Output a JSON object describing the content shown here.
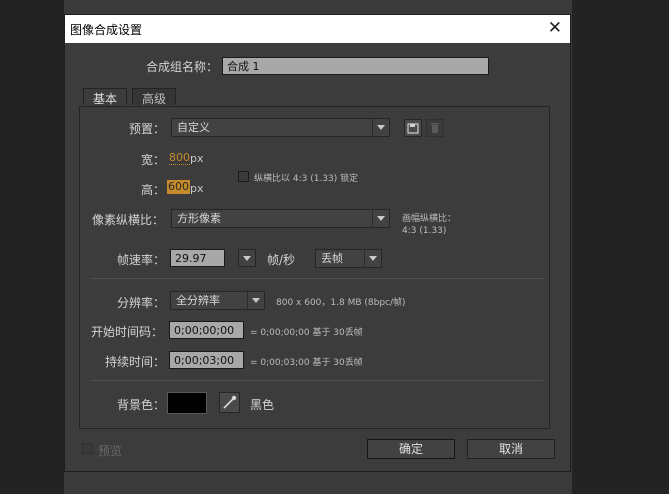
{
  "window": {
    "title": "图像合成设置",
    "close_glyph": "✕"
  },
  "comp_name": {
    "label": "合成组名称：",
    "value": "合成 1"
  },
  "tabs": [
    {
      "label": "基本"
    },
    {
      "label": "高级"
    }
  ],
  "preset": {
    "label": "预置：",
    "value": "自定义"
  },
  "width": {
    "label": "宽：",
    "value": "800",
    "unit": "px"
  },
  "height": {
    "label": "高：",
    "value": "600",
    "unit": "px"
  },
  "lock_aspect": {
    "label": "纵横比以 4:3 (1.33) 锁定",
    "checked": false
  },
  "pixel_aspect": {
    "label": "像素纵横比：",
    "value": "方形像素",
    "frame_aspect_label": "画幅纵横比：",
    "frame_aspect_value": "4:3 (1.33)"
  },
  "frame_rate": {
    "label": "帧速率：",
    "value": "29.97",
    "unit": "帧/秒",
    "drop_value": "丢帧"
  },
  "resolution": {
    "label": "分辨率：",
    "value": "全分辨率",
    "info": "800 x 600，1.8 MB (8bpc/帧)"
  },
  "start_timecode": {
    "label": "开始时间码：",
    "value": "0;00;00;00",
    "info": "= 0;00;00;00  基于 30丢帧"
  },
  "duration": {
    "label": "持续时间：",
    "value": "0;00;03;00",
    "info": "= 0;00;03;00  基于 30丢帧"
  },
  "background": {
    "label": "背景色：",
    "color": "#000000",
    "name": "黑色"
  },
  "footer": {
    "preview_label": "预览",
    "preview_checked": false,
    "ok_label": "确定",
    "cancel_label": "取消"
  }
}
